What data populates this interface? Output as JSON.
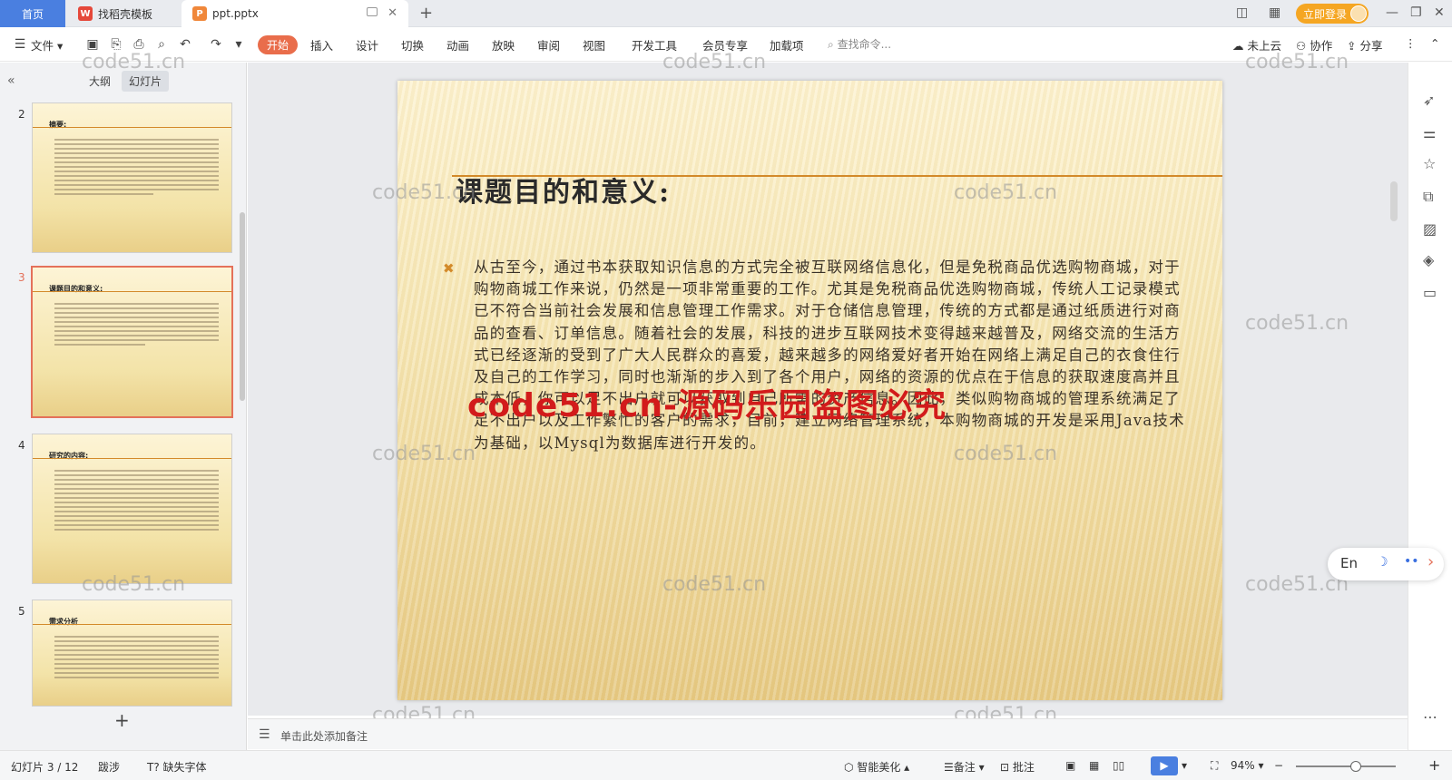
{
  "tabs": {
    "home": "首页",
    "find_template": "找稻壳模板",
    "document": "ppt.pptx"
  },
  "window": {
    "login": "立即登录"
  },
  "menu": {
    "file": "文件",
    "items": [
      "开始",
      "插入",
      "设计",
      "切换",
      "动画",
      "放映",
      "审阅",
      "视图",
      "开发工具",
      "会员专享",
      "加载项"
    ],
    "search_placeholder": "查找命令...",
    "cloud": "未上云",
    "collaborate": "协作",
    "share": "分享"
  },
  "left_panel": {
    "tabs": [
      "大纲",
      "幻灯片"
    ],
    "active_tab": "幻灯片",
    "thumbnails": [
      {
        "num": "2",
        "title": "摘要:"
      },
      {
        "num": "3",
        "title": "课题目的和意义:",
        "selected": true
      },
      {
        "num": "4",
        "title": "研究的内容:"
      },
      {
        "num": "5",
        "title": "需求分析"
      }
    ]
  },
  "slide": {
    "title": "课题目的和意义:",
    "body": "从古至今，通过书本获取知识信息的方式完全被互联网络信息化，但是免税商品优选购物商城，对于购物商城工作来说，仍然是一项非常重要的工作。尤其是免税商品优选购物商城，传统人工记录模式已不符合当前社会发展和信息管理工作需求。对于仓储信息管理，传统的方式都是通过纸质进行对商品的查看、订单信息。随着社会的发展，科技的进步互联网技术变得越来越普及，网络交流的生活方式已经逐渐的受到了广大人民群众的喜爱，越来越多的网络爱好者开始在网络上满足自己的衣食住行及自己的工作学习，同时也渐渐的步入到了各个用户，网络的资源的优点在于信息的获取速度高并且成本低，你可以足不出户就可以获取到自己所需的资产信息。因此，类似购物商城的管理系统满足了足不出户以及工作繁忙的客户的需求，目前，建立网络管理系统，本购物商城的开发是采用Java技术为基础，以Mysql为数据库进行开发的。"
  },
  "watermarks": {
    "site": "code51.cn",
    "red": "code51.cn-源码乐园盗图必究"
  },
  "notes": {
    "placeholder": "单击此处添加备注"
  },
  "float_tools": {
    "lang": "En"
  },
  "status": {
    "slide_pos": "幻灯片 3 / 12",
    "theme": "跋涉",
    "missing_font": "缺失字体",
    "beautify": "智能美化",
    "notes": "备注",
    "comments": "批注",
    "zoom": "94%",
    "zoom_fraction": 0.6
  }
}
